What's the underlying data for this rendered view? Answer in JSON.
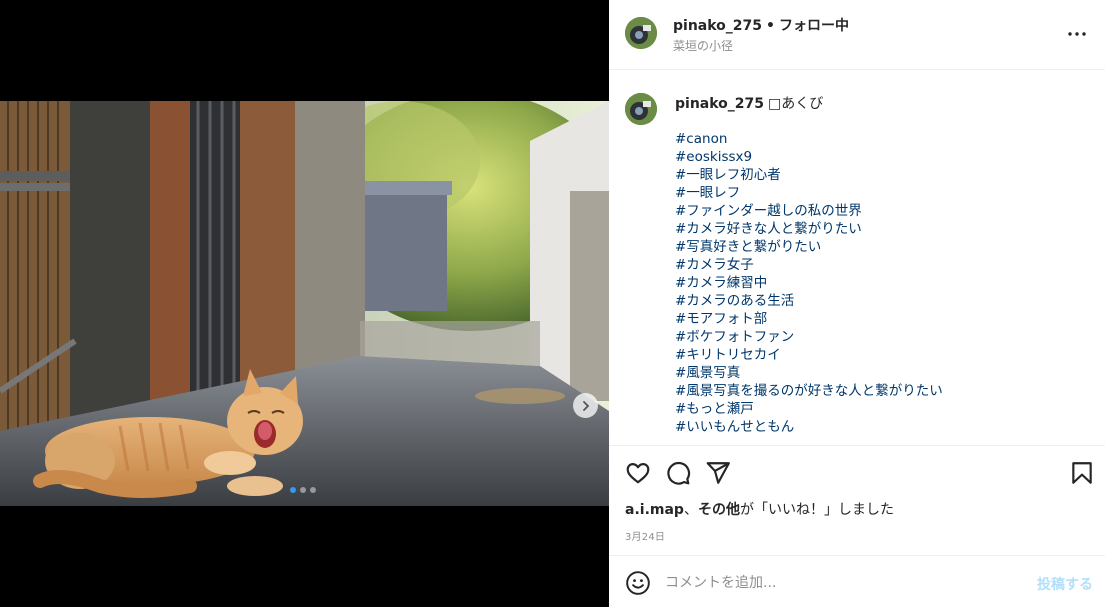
{
  "post": {
    "username": "pinako_275",
    "follow_status": "フォロー中",
    "separator": "•",
    "location": "菜垣の小径"
  },
  "caption": {
    "username": "pinako_275",
    "text": "□あくび",
    "hashtags": [
      "#canon",
      "#eoskissx9",
      "#一眼レフ初心者",
      "#一眼レフ",
      "#ファインダー越しの私の世界",
      "#カメラ好きな人と繋がりたい",
      "#写真好きと繋がりたい",
      "#カメラ女子",
      "#カメラ練習中",
      "#カメラのある生活",
      "#モアフォト部",
      "#ボケフォトファン",
      "#キリトリセカイ",
      "#風景写真",
      "#風景写真を撮るのが好きな人と繋がりたい",
      "#もっと瀬戸",
      "#いいもんせともん"
    ]
  },
  "likes": {
    "names": "a.i.map",
    "joiner": "、",
    "others": "その他",
    "suffix": "が「いいね！」しました"
  },
  "date": "3月24日",
  "comment": {
    "placeholder": "コメントを追加...",
    "post_label": "投稿する"
  },
  "carousel": {
    "slide_count": 3,
    "active_index": 0
  },
  "colors": {
    "hashtag": "#00376b",
    "active_dot": "#3897f0",
    "post_button_disabled": "#b2dffc",
    "secondary_text": "#8e8e8e"
  },
  "icons": {
    "like": "heart-icon",
    "comment": "comment-bubble-icon",
    "share": "paper-plane-icon",
    "save": "bookmark-icon",
    "more": "ellipsis-icon",
    "emoji": "smiley-icon",
    "next": "chevron-right-icon"
  }
}
